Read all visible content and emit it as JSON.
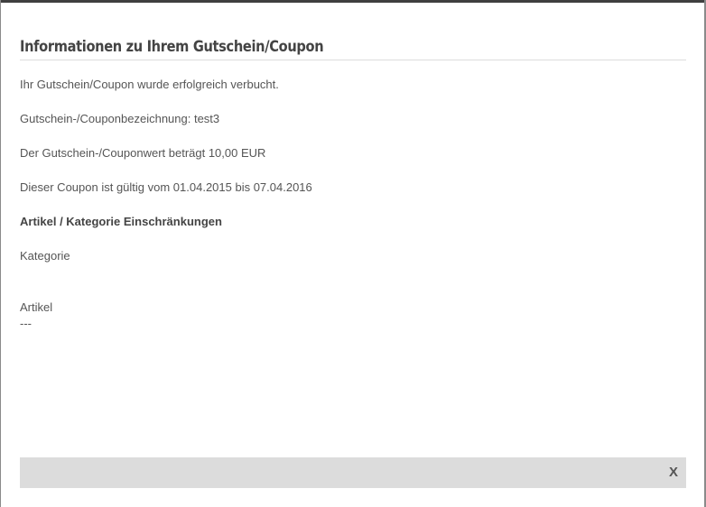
{
  "dialog": {
    "title": "Informationen zu Ihrem Gutschein/Coupon",
    "lines": {
      "booked": "Ihr Gutschein/Coupon wurde erfolgreich verbucht.",
      "name": "Gutschein-/Couponbezeichnung: test3",
      "value": "Der Gutschein-/Couponwert beträgt 10,00 EUR",
      "validity": "Dieser Coupon ist gültig vom 01.04.2015 bis 07.04.2016",
      "restrictions_heading": "Artikel / Kategorie Einschränkungen",
      "category_label": "Kategorie",
      "article_label": "Artikel",
      "article_value": "---"
    },
    "close_label": "X"
  }
}
